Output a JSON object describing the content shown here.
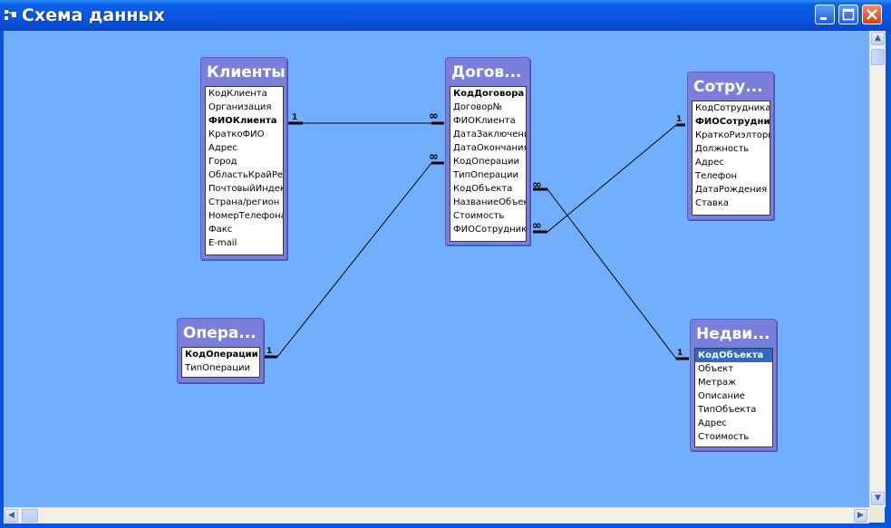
{
  "window": {
    "title": "Схема данных"
  },
  "tables": {
    "clients": {
      "title": "Клиенты",
      "fields": [
        "КодКлиента",
        "Организация",
        "ФИОКлиента",
        "КраткоФИО",
        "Адрес",
        "Город",
        "ОбластьКрайРес",
        "ПочтовыйИндек",
        "Страна/регион",
        "НомерТелефона",
        "Факс",
        "E-mail"
      ]
    },
    "contracts": {
      "title": "Догов...",
      "fields": [
        "КодДоговора",
        "Договор№",
        "ФИОКлиента",
        "ДатаЗаключени",
        "ДатаОкончания",
        "КодОперации",
        "ТипОперации",
        "КодОбъекта",
        "НазваниеОбъект",
        "Стоимость",
        "ФИОСотрудника"
      ]
    },
    "employees": {
      "title": "Сотру...",
      "fields": [
        "КодСотрудника",
        "ФИОСотрудника",
        "КраткоРиэлторь",
        "Должность",
        "Адрес",
        "Телефон",
        "ДатаРождения",
        "Ставка"
      ]
    },
    "operations": {
      "title": "Опера...",
      "fields": [
        "КодОперации",
        "ТипОперации"
      ]
    },
    "realty": {
      "title": "Недви...",
      "fields": [
        "КодОбъекта",
        "Объект",
        "Метраж",
        "Описание",
        "ТипОбъекта",
        "Адрес",
        "Стоимость"
      ]
    }
  },
  "relationships": {
    "one_label": "1",
    "many_label": "∞"
  },
  "colors": {
    "canvas": "#71aefc",
    "table": "#7b7fdc",
    "titlebar": "#0a55e0",
    "selection": "#316ac5"
  }
}
